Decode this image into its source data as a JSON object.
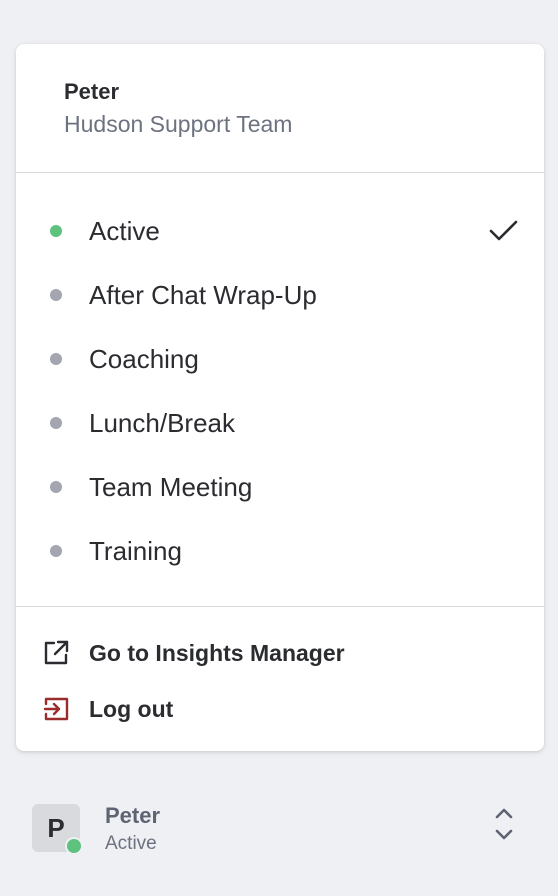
{
  "user": {
    "name": "Peter",
    "team": "Hudson Support Team"
  },
  "statuses": [
    {
      "label": "Active",
      "color": "#5cc27d",
      "selected": true
    },
    {
      "label": "After Chat Wrap-Up",
      "color": "#a3a6b0",
      "selected": false
    },
    {
      "label": "Coaching",
      "color": "#a3a6b0",
      "selected": false
    },
    {
      "label": "Lunch/Break",
      "color": "#a3a6b0",
      "selected": false
    },
    {
      "label": "Team Meeting",
      "color": "#a3a6b0",
      "selected": false
    },
    {
      "label": "Training",
      "color": "#a3a6b0",
      "selected": false
    }
  ],
  "actions": [
    {
      "label": "Go to Insights Manager",
      "icon": "external-link-icon",
      "color": "#2b2c30"
    },
    {
      "label": "Log out",
      "icon": "log-out-icon",
      "color": "#9b2c2c"
    }
  ],
  "footer": {
    "avatar_letter": "P",
    "name": "Peter",
    "status": "Active",
    "presence_color": "#5cc27d"
  },
  "icons": {
    "selected": "checkmark-icon",
    "toggle": "chevron-up-down-icon"
  }
}
